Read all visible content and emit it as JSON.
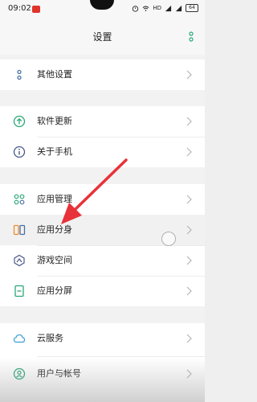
{
  "status_bar": {
    "time": "09:02",
    "network_label": "HD",
    "battery_level": "64"
  },
  "header": {
    "title": "设置"
  },
  "menu_items": [
    {
      "label": "其他设置",
      "icon": "more-dots-icon"
    },
    {
      "label": "软件更新",
      "icon": "upload-arrow-icon"
    },
    {
      "label": "关于手机",
      "icon": "info-icon"
    },
    {
      "label": "应用管理",
      "icon": "apps-grid-icon"
    },
    {
      "label": "应用分身",
      "icon": "app-clone-icon"
    },
    {
      "label": "游戏空间",
      "icon": "game-space-icon"
    },
    {
      "label": "应用分屏",
      "icon": "split-screen-icon"
    },
    {
      "label": "云服务",
      "icon": "cloud-icon"
    },
    {
      "label": "用户与帐号",
      "icon": "user-account-icon"
    }
  ],
  "colors": {
    "accent_green": "#2aa876",
    "annotation_red": "#e8323a",
    "clone_orange": "#f08c2c"
  }
}
